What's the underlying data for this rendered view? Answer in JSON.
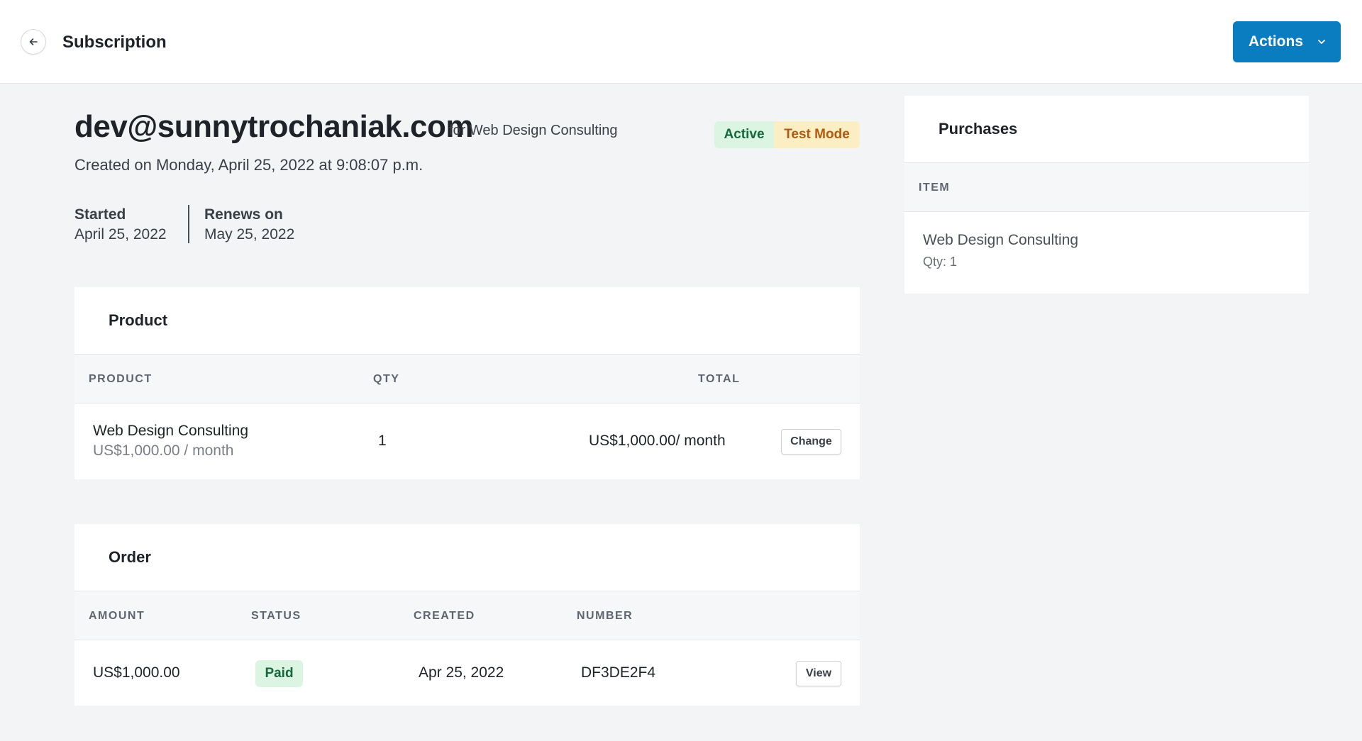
{
  "header": {
    "title": "Subscription",
    "actions_label": "Actions"
  },
  "summary": {
    "email": "dev@sunnytrochaniak.com",
    "for_label": "for Web Design Consulting",
    "badges": {
      "active": "Active",
      "test_mode": "Test Mode"
    },
    "created_on": "Created on Monday, April 25, 2022 at 9:08:07 p.m.",
    "started_label": "Started",
    "started_value": "April 25, 2022",
    "renews_label": "Renews on",
    "renews_value": "May 25, 2022"
  },
  "product_card": {
    "title": "Product",
    "columns": [
      "PRODUCT",
      "QTY",
      "TOTAL"
    ],
    "row": {
      "name": "Web Design Consulting",
      "price": "US$1,000.00 / month",
      "qty": "1",
      "total": "US$1,000.00/ month",
      "change_label": "Change"
    }
  },
  "order_card": {
    "title": "Order",
    "columns": [
      "AMOUNT",
      "STATUS",
      "CREATED",
      "NUMBER"
    ],
    "row": {
      "amount": "US$1,000.00",
      "status": "Paid",
      "created": "Apr 25, 2022",
      "number": "DF3DE2F4",
      "view_label": "View"
    }
  },
  "purchases_card": {
    "title": "Purchases",
    "column": "ITEM",
    "item": {
      "name": "Web Design Consulting",
      "qty": "Qty: 1"
    }
  },
  "icons": {
    "back": "arrow-left-icon",
    "actions": "chevron-down-icon"
  },
  "colors": {
    "primary": "#0a7cc0",
    "active_bg": "#dcf5e3",
    "active_text": "#15693a",
    "test_bg": "#fbeec2",
    "test_text": "#b25b10"
  }
}
